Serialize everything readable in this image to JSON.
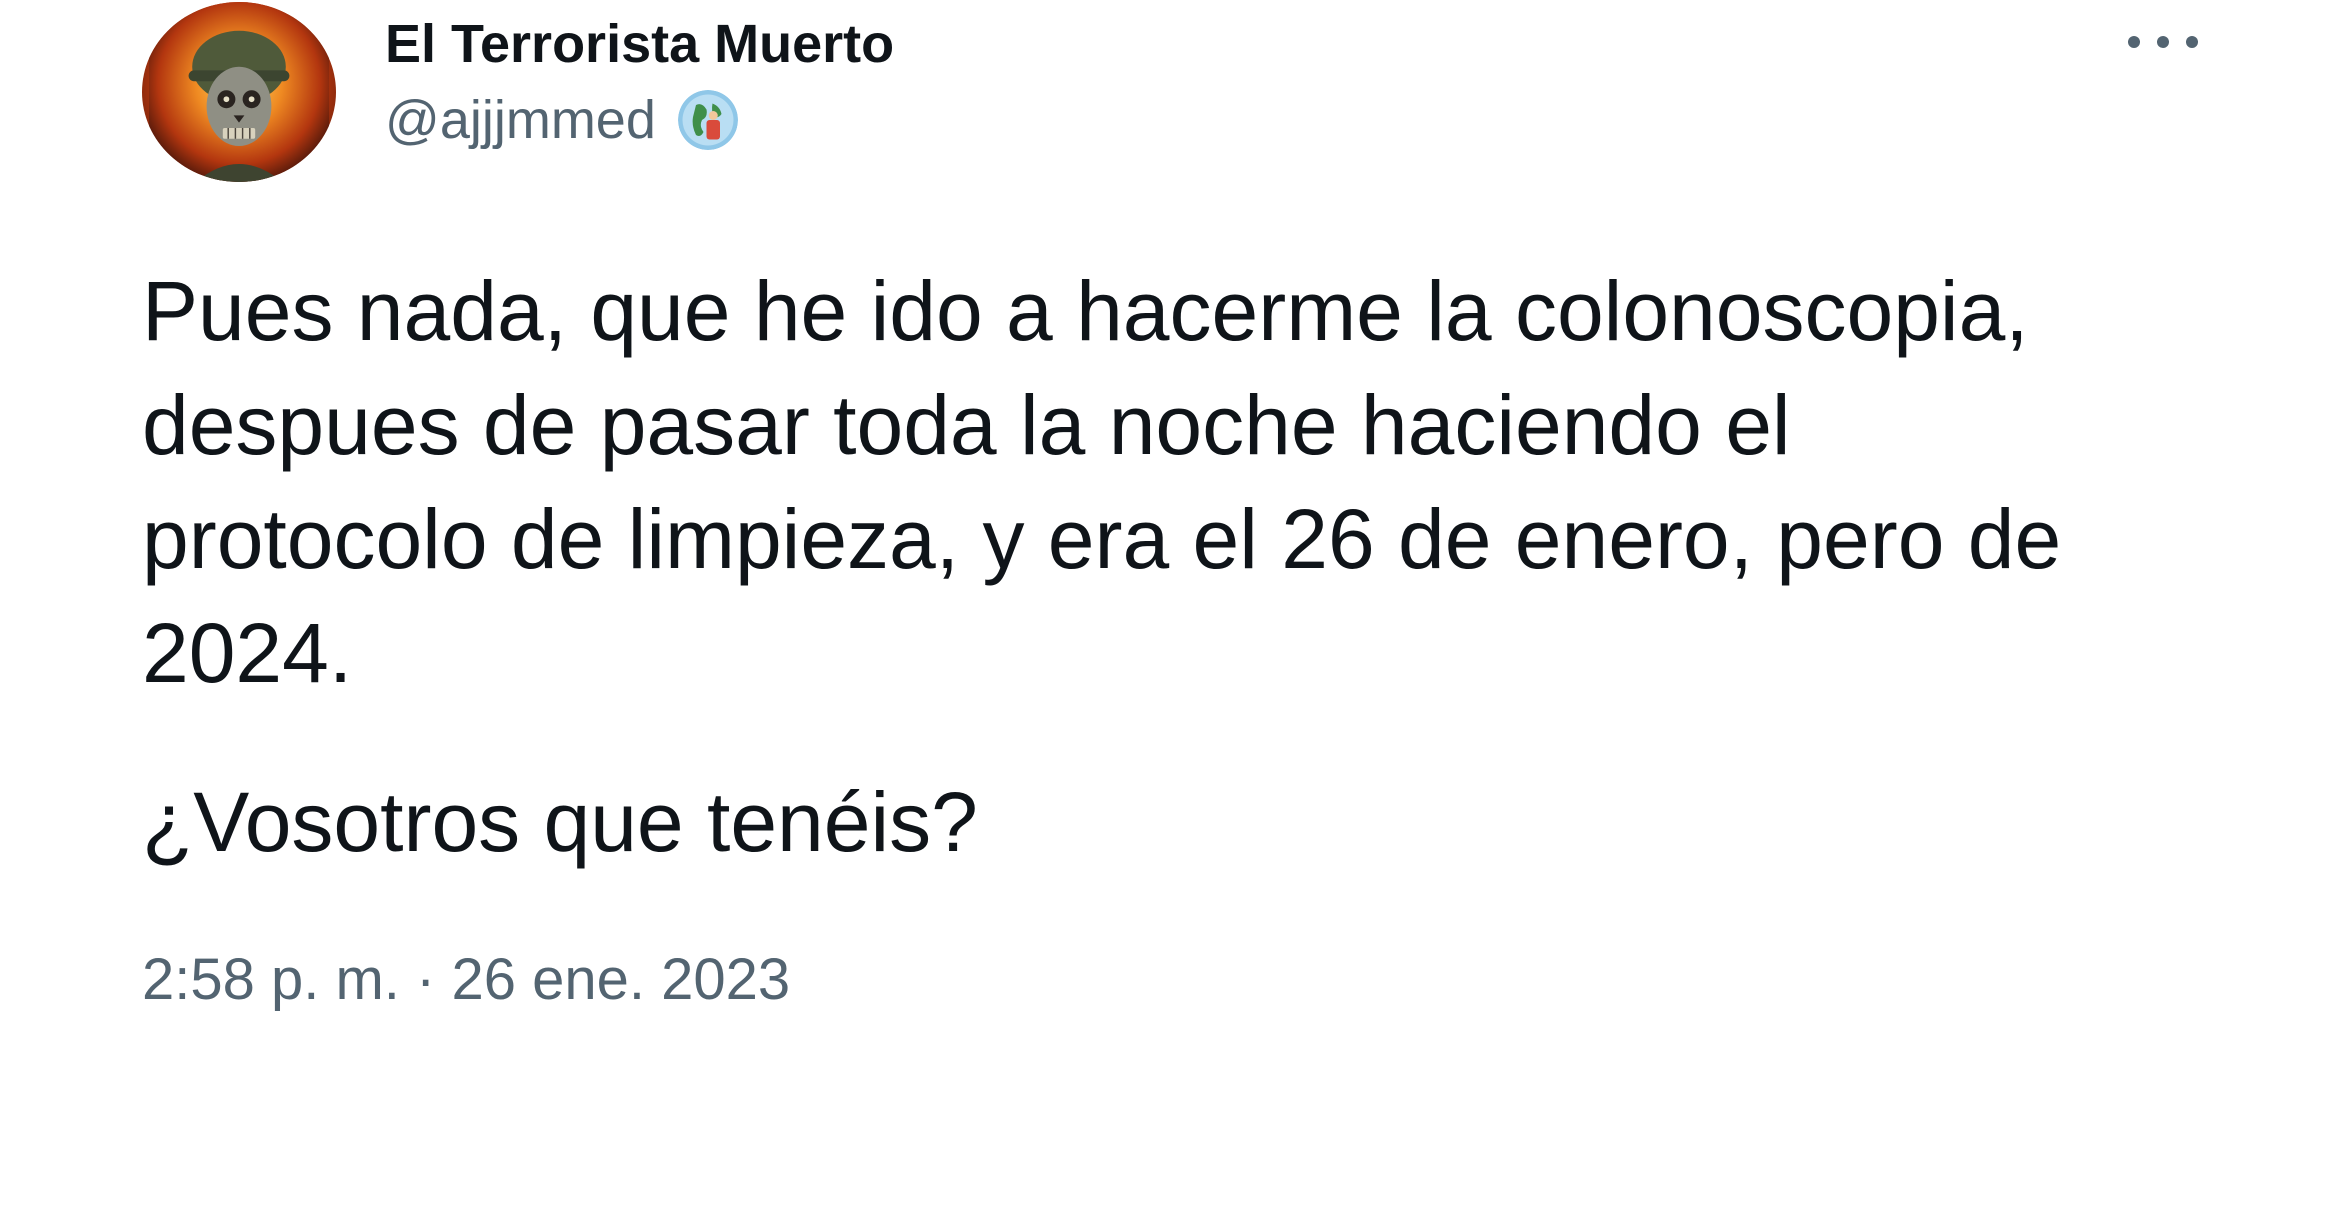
{
  "tweet": {
    "author_name": "El Terrorista Muerto",
    "author_handle": "@ajjjmmed",
    "body": "Pues nada, que he ido a hacerme la colonoscopia,\ndespues de pasar toda la noche haciendo el\nprotocolo de limpieza, y era el 26 de enero, pero de\n2024.",
    "question": "¿Vosotros que tenéis?",
    "timestamp": "2:58 p. m. · 26 ene. 2023"
  },
  "icons": {
    "avatar": "avatar-skull-soldier-image",
    "badge": "globe-badge-icon",
    "more": "more-options-icon"
  },
  "colors": {
    "text_primary": "#0f1419",
    "text_secondary": "#536471",
    "background": "#ffffff"
  }
}
